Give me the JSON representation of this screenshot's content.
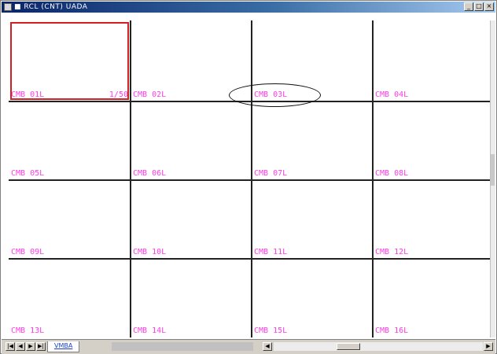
{
  "window": {
    "title": "■ RCL (CNT) UADA",
    "minimize_glyph": "_",
    "maximize_glyph": "□",
    "close_glyph": "×"
  },
  "grid": {
    "cells": [
      {
        "label": "CMB 01L",
        "counter": "1/50"
      },
      {
        "label": "CMB 02L"
      },
      {
        "label": "CMB 03L"
      },
      {
        "label": "CMB 04L"
      },
      {
        "label": "CMB 05L"
      },
      {
        "label": "CMB 06L"
      },
      {
        "label": "CMB 07L"
      },
      {
        "label": "CMB 08L"
      },
      {
        "label": "CMB 09L"
      },
      {
        "label": "CMB 10L"
      },
      {
        "label": "CMB 11L"
      },
      {
        "label": "CMB 12L"
      },
      {
        "label": "CMB 13L"
      },
      {
        "label": "CMB 14L"
      },
      {
        "label": "CMB 15L"
      },
      {
        "label": "CMB 16L"
      }
    ],
    "label_color": "#ff3ce6",
    "selected_border_color": "#d02020",
    "highlighted_cell": "CMB 03L"
  },
  "bottombar": {
    "nav": [
      "|◀",
      "◀",
      "▶",
      "▶|"
    ],
    "sheet_tab": "VMBA",
    "scroll_left": "◀",
    "scroll_right": "▶"
  }
}
